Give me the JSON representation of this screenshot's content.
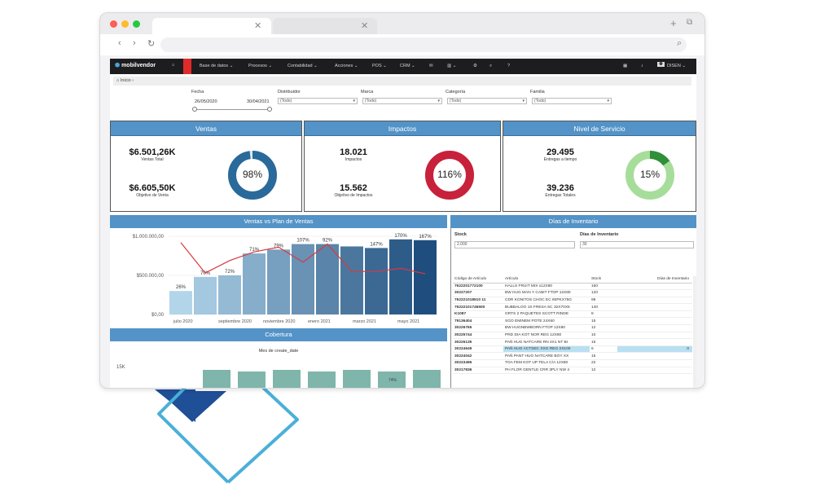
{
  "colors": {
    "panel_header": "#5393c7",
    "bar_light": "#b2d5ea",
    "bar_mid": "#6f9fcd",
    "bar_dark": "#1f4e7e",
    "plan_line": "#d9383f",
    "donut_ventas": "#2a6a9a",
    "donut_impactos": "#c8213b",
    "donut_servicio": "#a7dd9a",
    "donut_servicio_fill": "#2f8f3a",
    "cobertura_bar": "#7fb5ab",
    "deco_blue": "#1e4f97",
    "deco_outline": "#4ab0d8"
  },
  "nav": {
    "logo": "mobilvendor",
    "items": [
      "Base de datos",
      "Procesos",
      "Contabilidad",
      "Acciones",
      "POS",
      "CRM"
    ],
    "user": "DISEN",
    "icons": [
      "home-icon",
      "mail-icon",
      "chart-icon",
      "gear-icon",
      "search-icon",
      "help-icon",
      "calendar-icon",
      "bell-icon",
      "avatar-icon"
    ]
  },
  "breadcrumb": "Inicio",
  "filters": {
    "fecha_label": "Fecha",
    "fecha_from": "26/05/2020",
    "fecha_to": "30/04/2021",
    "distribuidor_label": "Distribuidor",
    "distribuidor_value": "(Todo)",
    "marca_label": "Marca",
    "marca_value": "(Todo)",
    "categoria_label": "Categoría",
    "categoria_value": "(Todo)",
    "familia_label": "Familia",
    "familia_value": "(Todo)"
  },
  "ventas": {
    "title": "Ventas",
    "total_value": "$6.501,26K",
    "total_label": "Ventas Total",
    "objetivo_value": "$6.605,50K",
    "objetivo_label": "Objetivo de Venta",
    "percent": "98%",
    "percent_value": 0.98
  },
  "impactos": {
    "title": "Impactos",
    "value": "18.021",
    "value_label": "Impactos",
    "objetivo_value": "15.562",
    "objetivo_label": "Objetivo de Impactos",
    "percent": "116%",
    "percent_value": 1.0
  },
  "servicio": {
    "title": "Nivel de Servicio",
    "tiempo_value": "29.495",
    "tiempo_label": "Entregas a tiempo",
    "totales_value": "39.236",
    "totales_label": "Entregas Totales",
    "percent": "15%",
    "percent_value": 0.15
  },
  "chart_data": {
    "type": "bar",
    "title": "Ventas vs Plan de Ventas",
    "y_ticks": [
      "$1.000.000,00",
      "$500.000,00",
      "$0,00"
    ],
    "x_labels": [
      "julio 2020",
      "septiembre 2020",
      "noviembre 2020",
      "enero 2021",
      "marzo 2021",
      "mayo 2021"
    ],
    "ylim": [
      0,
      1000000
    ],
    "bar_values": [
      300000,
      480000,
      500000,
      780000,
      830000,
      900000,
      900000,
      870000,
      850000,
      960000,
      950000
    ],
    "bar_labels": [
      "26%",
      "70%",
      "72%",
      "71%",
      "79%",
      "107%",
      "92%",
      "",
      "147%",
      "170%",
      "167%"
    ],
    "plan_values": [
      920000,
      530000,
      690000,
      800000,
      860000,
      670000,
      900000,
      550000,
      550000,
      590000,
      520000
    ]
  },
  "cobertura": {
    "title": "Cobertura",
    "subtitle": "Mes de create_date",
    "y_tick": "15K",
    "bar_label": "74%"
  },
  "inventario": {
    "title": "Días de Inventario",
    "stock_label": "Stock",
    "stock_value": "2.000",
    "dias_label": "Días de Inventario",
    "dias_value": "30",
    "columns": [
      "Código de Artículo",
      "Artículo",
      "Stock",
      "Días de Inventario"
    ],
    "rows": [
      [
        "7622201772100",
        "HALLS FRUIT MIX x12X80",
        "150",
        ""
      ],
      [
        "30227207",
        "BW HUG MAN Y CABIT FTOP 12X80",
        "120",
        ""
      ],
      [
        "762221018510 11",
        "CDR KONITOS CHOC EC 80PKX75G",
        "98",
        ""
      ],
      [
        "76222101746500",
        "BUBBALOO 1S FRESA SC 32X70X5",
        "140",
        ""
      ],
      [
        "K1087",
        "GRTS 2 PAQUETES  SCOTT RINDE",
        "8",
        ""
      ],
      [
        "79136404",
        "SGO EMINEM POTE 24X60",
        "15",
        ""
      ],
      [
        "30226765",
        "BW HUGNBWBORN FTOP 12X80",
        "12",
        ""
      ],
      [
        "30225744",
        "PRD DIA KOT NOR REG 12X80",
        "10",
        ""
      ],
      [
        "30225135",
        "PAÑ HUG NATCARE RN 4X1 NT BI",
        "15",
        ""
      ],
      [
        "30224649",
        "PAÑ HUG ACTSEC XXG REG 2X100",
        "6",
        "0"
      ],
      [
        "30224042",
        "PAÑ PANT HUG NATCARE BOY XX",
        "15",
        ""
      ],
      [
        "30223496",
        "TOA FEM KOT UP TELA C/A 12X80",
        "22",
        ""
      ],
      [
        "30217836",
        "PH FLOR GENTLE CRR 3PLY NW 4",
        "12",
        ""
      ]
    ]
  }
}
